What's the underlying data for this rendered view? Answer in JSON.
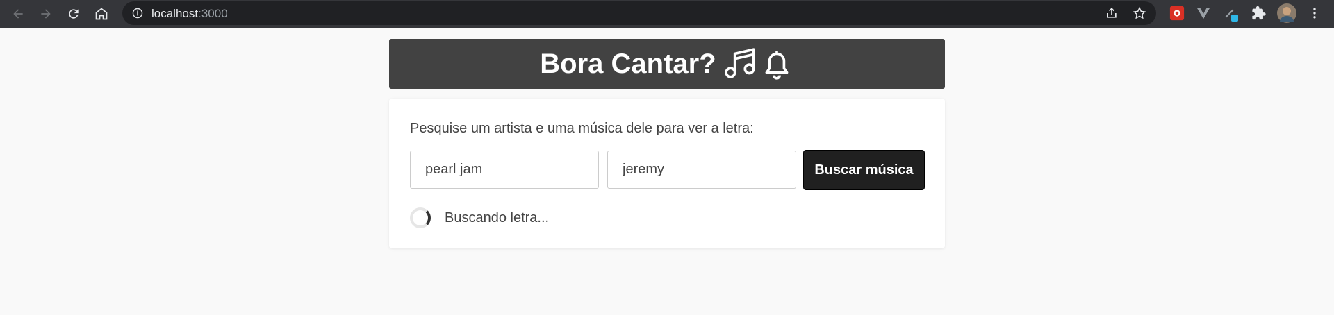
{
  "browser": {
    "url_host": "localhost",
    "url_port": ":3000",
    "icons": [
      "back-icon",
      "forward-icon",
      "reload-icon",
      "home-icon",
      "info-icon",
      "share-icon",
      "star-icon",
      "extension-icon",
      "avatar",
      "menu-icon"
    ]
  },
  "header": {
    "title": "Bora Cantar?",
    "icons": [
      "music-note-icon",
      "bell-icon"
    ]
  },
  "search": {
    "prompt": "Pesquise um artista e uma música dele para ver a letra:",
    "artist_value": "pearl jam",
    "song_value": "jeremy",
    "button_label": "Buscar música"
  },
  "status": {
    "loading_text": "Buscando letra..."
  },
  "colors": {
    "header_bg": "#424242",
    "button_bg": "#202020",
    "page_bg": "#f9f9f9"
  }
}
